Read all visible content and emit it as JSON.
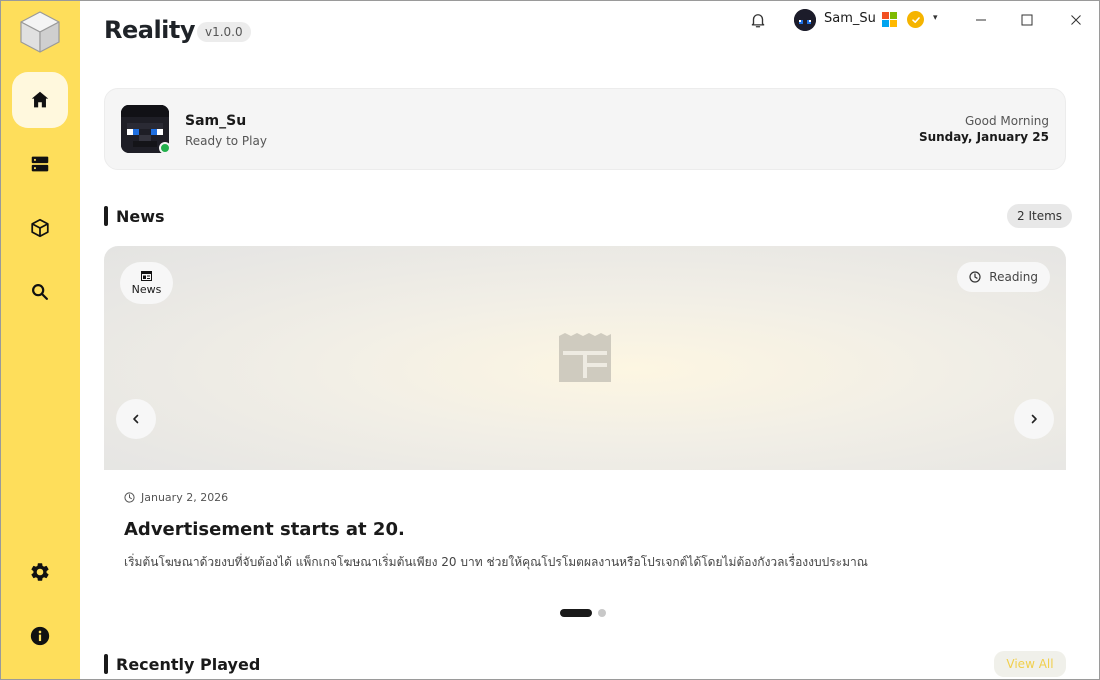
{
  "app": {
    "title": "Reality",
    "version": "v1.0.0"
  },
  "titlebar": {
    "username": "Sam_Su",
    "ms_colors": [
      "#f25022",
      "#7fba00",
      "#00a4ef",
      "#ffb900"
    ]
  },
  "sidebar": {
    "items": [
      {
        "name": "home",
        "icon": "home-icon",
        "active": true
      },
      {
        "name": "servers",
        "icon": "server-icon",
        "active": false
      },
      {
        "name": "packages",
        "icon": "cube-icon",
        "active": false
      },
      {
        "name": "search",
        "icon": "search-icon",
        "active": false
      }
    ],
    "bottom": [
      {
        "name": "settings",
        "icon": "gear-icon"
      },
      {
        "name": "info",
        "icon": "info-icon"
      }
    ]
  },
  "greeting": {
    "name": "Sam_Su",
    "status": "Ready to Play",
    "hello": "Good Morning",
    "date": "Sunday, January 25"
  },
  "news": {
    "section_title": "News",
    "count": "2 Items",
    "tag": "News",
    "reading": "Reading",
    "date": "January 2, 2026",
    "title": "Advertisement starts at 20.",
    "body": "เริ่มต้นโฆษณาด้วยงบที่จับต้องได้ แพ็กเกจโฆษณาเริ่มต้นเพียง 20 บาท ช่วยให้คุณโปรโมตผลงานหรือโปรเจกต์ได้โดยไม่ต้องกังวลเรื่องงบประมาณ",
    "page": 1,
    "total_pages": 2
  },
  "recent": {
    "section_title": "Recently Played",
    "view_all": "View All"
  },
  "colors": {
    "sidebar": "#FEDE5B",
    "accent": "#F5B400",
    "online": "#22B14C"
  }
}
